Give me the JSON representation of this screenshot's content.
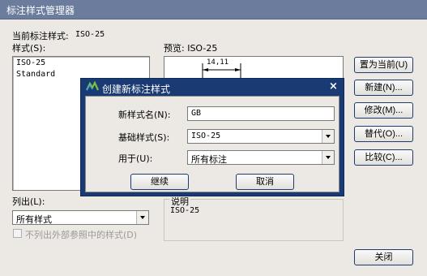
{
  "window": {
    "title": "标注样式管理器"
  },
  "current_style": {
    "label": "当前标注样式:",
    "value": "ISO-25"
  },
  "styles": {
    "label": "样式(S):",
    "items": [
      "ISO-25",
      "Standard"
    ]
  },
  "preview": {
    "label": "预览: ISO-25",
    "dimension": "14,11"
  },
  "list_out": {
    "label": "列出(L):",
    "selected": "所有样式",
    "checkbox_label": "不列出外部参照中的样式(D)"
  },
  "description": {
    "label": "说明",
    "value": "ISO-25"
  },
  "buttons": {
    "set_current": "置为当前(U)",
    "new": "新建(N)...",
    "modify": "修改(M)...",
    "override": "替代(O)...",
    "compare": "比较(C)...",
    "close": "关闭"
  },
  "dialog": {
    "title": "创建新标注样式",
    "close_glyph": "×",
    "new_name_label": "新样式名(N):",
    "new_name_value": "GB",
    "base_style_label": "基础样式(S):",
    "base_style_value": "ISO-25",
    "use_for_label": "用于(U):",
    "use_for_value": "所有标注",
    "continue": "继续",
    "cancel": "取消"
  },
  "colors": {
    "titlebar": "#6b7c9c",
    "dialog_frame": "#1a3a73",
    "window_bg": "#ece9e4"
  }
}
